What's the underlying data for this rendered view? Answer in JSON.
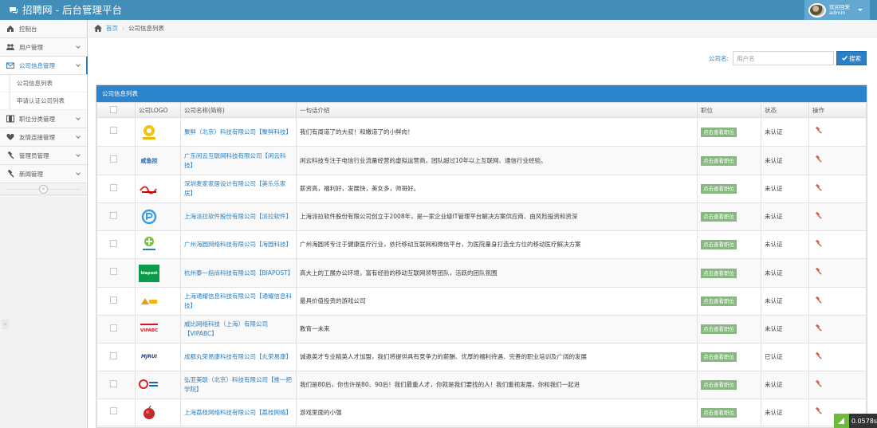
{
  "header": {
    "title": "招聘网 - 后台管理平台",
    "welcome": "欢迎回来",
    "username": "admin"
  },
  "sidebar": {
    "items": [
      {
        "label": "控制台",
        "icon": "tachometer-icon"
      },
      {
        "label": "用户管理",
        "icon": "users-icon"
      },
      {
        "label": "公司信息管理",
        "icon": "envelope-icon",
        "active": true
      },
      {
        "label": "职位分类管理",
        "icon": "film-icon"
      },
      {
        "label": "友情连接管理",
        "icon": "heart-icon"
      },
      {
        "label": "管理员管理",
        "icon": "gavel-icon"
      },
      {
        "label": "新闻管理",
        "icon": "gavel-icon"
      }
    ],
    "subitems": [
      "公司信息列表",
      "申请认证公司列表"
    ]
  },
  "breadcrumb": {
    "home": "首页",
    "current": "公司信息列表"
  },
  "search": {
    "label": "公司名:",
    "placeholder": "用户名",
    "button": "搜索"
  },
  "panel": {
    "title": "公司信息列表"
  },
  "table": {
    "headers": [
      "公司LOGO",
      "公司名称(简称)",
      "一句话介绍",
      "职位",
      "状态",
      "操作"
    ],
    "rows": [
      {
        "logo": "yellow-circle",
        "name": "聚鲜（北京）科技有限公司【聚鲜科技】",
        "intro": "我们有周道了的大叔！和嫩道了的小鲜肉！",
        "job": "点击查看职位",
        "status": "未认证"
      },
      {
        "logo": "text-blue",
        "logo_text": "咸鱼控",
        "name": "广东闲云互联网科技有限公司【闲云科技】",
        "intro": "闲云科技专注于电信行业流量经营的虚拟运营商，团队超过10年以上互联网、通信行业经验。",
        "job": "点击查看职位",
        "status": "未认证"
      },
      {
        "logo": "red-mark",
        "name": "深圳麦家家居设计有限公司【美乐乐家居】",
        "intro": "薪资高，福利好，发展快，美女多，帅哥好。",
        "job": "点击查看职位",
        "status": "未认证"
      },
      {
        "logo": "blue-ring",
        "name": "上海派拉软件股份有限公司【派拉软件】",
        "intro": "上海派拉软件股份有限公司创立于2008年，是一家企业级IT管理平台解决方案供应商、由风险投资和资深",
        "job": "点击查看职位",
        "status": "未认证"
      },
      {
        "logo": "green-blue",
        "name": "广州海圆网络科技有限公司【海圆科技】",
        "intro": "广州海圆将专注于健康医疗行业，依托移动互联网和微信平台，为医院量身打造全方位的移动医疗解决方案",
        "job": "点击查看职位",
        "status": "未认证"
      },
      {
        "logo": "green-box",
        "logo_text": "biapost",
        "name": "杭州泰一指尚科技有限公司【BIAPOST】",
        "intro": "高大上的工展办公环境，富有经验的移动互联网领导团队，活跃的团队氛围",
        "job": "点击查看职位",
        "status": "未认证"
      },
      {
        "logo": "orange-text",
        "name": "上海通耀信息科技有限公司【通耀信息科技】",
        "intro": "最具价值投资的游戏公司",
        "job": "点击查看职位",
        "status": "未认证"
      },
      {
        "logo": "red-text",
        "logo_text": "VIPABC",
        "name": "威比网络科技（上海）有限公司【VIPABC】",
        "intro": "教育一未来",
        "job": "点击查看职位",
        "status": "未认证"
      },
      {
        "logo": "dark-text",
        "logo_text": "MJRUI",
        "name": "成都丸荣易康科技有限公司【丸荣易康】",
        "intro": "诚邀英才专业精英人才加盟，我们将提供具有竞争力的薪酬、优厚的福利待遇、完善的职业培训及广阔的发展",
        "job": "点击查看职位",
        "status": "已认证"
      },
      {
        "logo": "red-blue",
        "name": "弘亚美联（北京）科技有限公司【推一把学院】",
        "intro": "我们是80后，你也许是80、90后！我们最重人才，你就是我们要找的人！我们重视发展，你和我们一起进",
        "job": "点击查看职位",
        "status": "未认证"
      },
      {
        "logo": "red-fruit",
        "name": "上海荔枝网络科技有限公司【荔枝网络】",
        "intro": "游戏里面的小强",
        "job": "点击查看职位",
        "status": "未认证"
      }
    ]
  },
  "debug": {
    "time": "0.0578s"
  },
  "colors": {
    "topbar": "#438eb9",
    "accent": "#2b7dbc",
    "tag": "#87b87f",
    "op": "#d15b47"
  }
}
